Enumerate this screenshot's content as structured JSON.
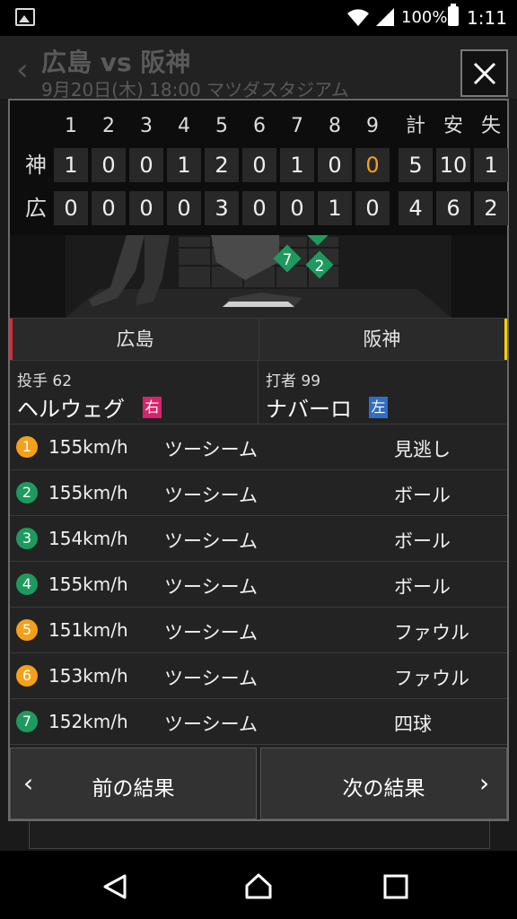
{
  "status_bar": {
    "battery": "100%",
    "time": "1:11"
  },
  "background_header": {
    "title": "広島 vs 阪神",
    "subtitle": "9月20日(木) 18:00 マツダスタジアム"
  },
  "scoreboard": {
    "innings": [
      "1",
      "2",
      "3",
      "4",
      "5",
      "6",
      "7",
      "8",
      "9"
    ],
    "totals_headers": [
      "計",
      "安",
      "失"
    ],
    "rows": [
      {
        "team": "神",
        "scores": [
          "1",
          "0",
          "0",
          "1",
          "2",
          "0",
          "1",
          "0",
          "0"
        ],
        "totals": [
          "5",
          "10",
          "1"
        ]
      },
      {
        "team": "広",
        "scores": [
          "0",
          "0",
          "0",
          "0",
          "3",
          "0",
          "0",
          "1",
          "0"
        ],
        "totals": [
          "4",
          "6",
          "2"
        ]
      }
    ],
    "highlight_color": "#f5a01a"
  },
  "field": {
    "markers": [
      "7",
      "2"
    ]
  },
  "teams": {
    "left": "広島",
    "right": "阪神"
  },
  "pitcher": {
    "role": "投手 62",
    "name": "ヘルウェグ",
    "hand": "右"
  },
  "batter": {
    "role": "打者 99",
    "name": "ナバーロ",
    "hand": "左"
  },
  "pitches": [
    {
      "n": "1",
      "color": "orange",
      "speed": "155km/h",
      "type": "ツーシーム",
      "result": "見逃し"
    },
    {
      "n": "2",
      "color": "green",
      "speed": "155km/h",
      "type": "ツーシーム",
      "result": "ボール"
    },
    {
      "n": "3",
      "color": "green",
      "speed": "154km/h",
      "type": "ツーシーム",
      "result": "ボール"
    },
    {
      "n": "4",
      "color": "green",
      "speed": "155km/h",
      "type": "ツーシーム",
      "result": "ボール"
    },
    {
      "n": "5",
      "color": "orange",
      "speed": "151km/h",
      "type": "ツーシーム",
      "result": "ファウル"
    },
    {
      "n": "6",
      "color": "orange",
      "speed": "153km/h",
      "type": "ツーシーム",
      "result": "ファウル"
    },
    {
      "n": "7",
      "color": "green",
      "speed": "152km/h",
      "type": "ツーシーム",
      "result": "四球"
    }
  ],
  "nav": {
    "prev": "前の結果",
    "next": "次の結果"
  },
  "colors": {
    "carp_red": "#d62e3c",
    "tigers_yellow": "#f4d000",
    "strike_orange": "#f5a01a",
    "ball_green": "#1f9a5e"
  }
}
